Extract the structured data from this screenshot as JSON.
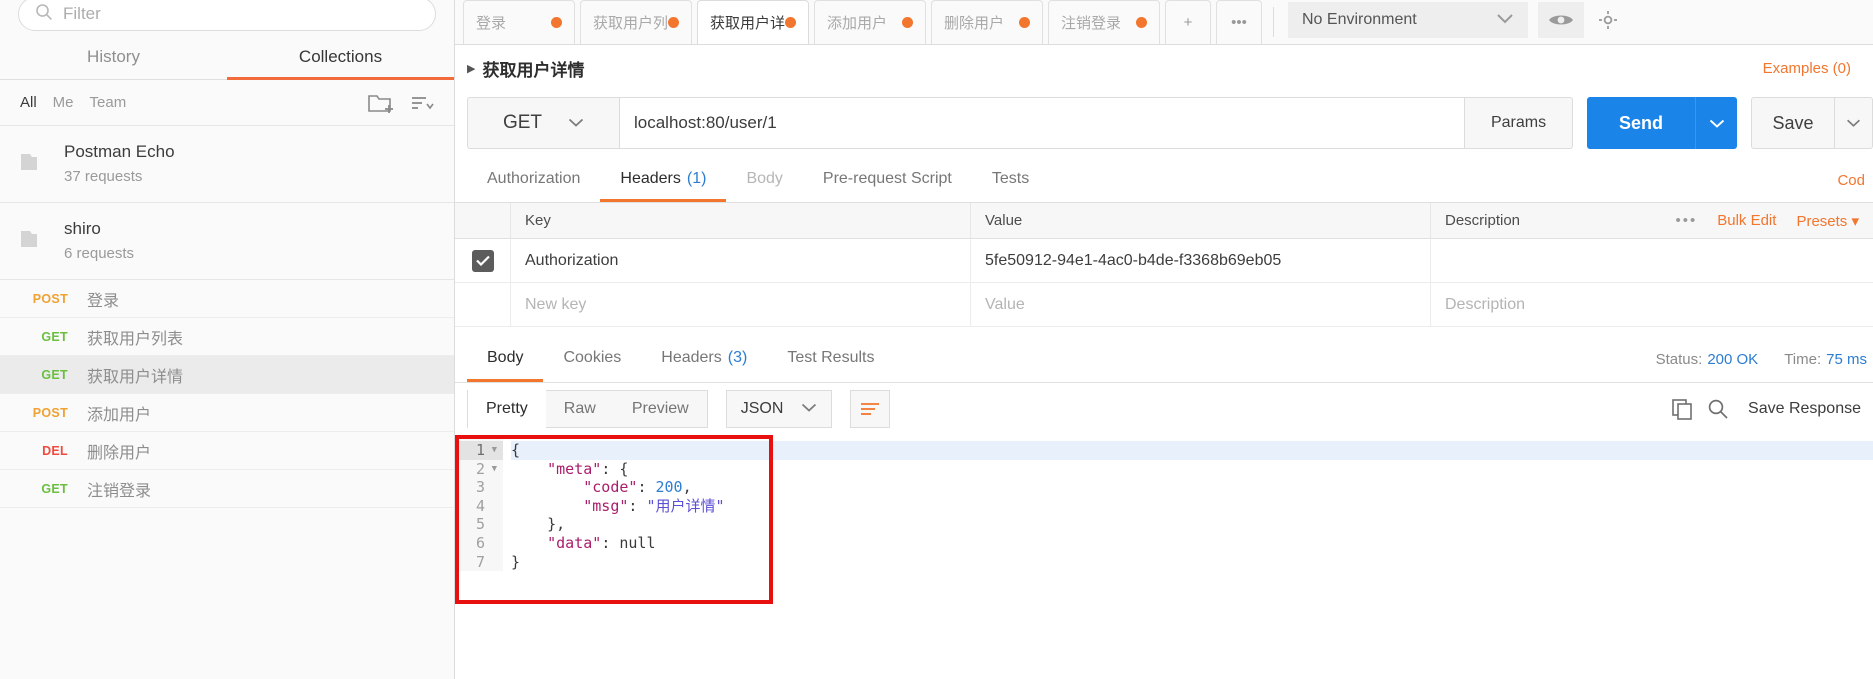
{
  "sidebar": {
    "filter_placeholder": "Filter",
    "tabs": [
      {
        "label": "History",
        "active": false
      },
      {
        "label": "Collections",
        "active": true
      }
    ],
    "scope_filters": [
      {
        "label": "All",
        "active": true
      },
      {
        "label": "Me",
        "active": false
      },
      {
        "label": "Team",
        "active": false
      }
    ],
    "new_folder_icon": "new-folder-icon",
    "sort_icon": "sort-icon",
    "collections": [
      {
        "name": "Postman Echo",
        "count": "37 requests"
      },
      {
        "name": "shiro",
        "count": "6 requests"
      }
    ],
    "requests": [
      {
        "method": "POST",
        "name": "登录",
        "selected": false
      },
      {
        "method": "GET",
        "name": "获取用户列表",
        "selected": false
      },
      {
        "method": "GET",
        "name": "获取用户详情",
        "selected": true
      },
      {
        "method": "POST",
        "name": "添加用户",
        "selected": false
      },
      {
        "method": "DEL",
        "name": "删除用户",
        "selected": false
      },
      {
        "method": "GET",
        "name": "注销登录",
        "selected": false
      }
    ]
  },
  "tabbar": {
    "tabs": [
      {
        "label": "登录",
        "active": false,
        "dirty": true
      },
      {
        "label": "获取用户列",
        "active": false,
        "dirty": true
      },
      {
        "label": "获取用户详",
        "active": true,
        "dirty": true
      },
      {
        "label": "添加用户",
        "active": false,
        "dirty": true
      },
      {
        "label": "删除用户",
        "active": false,
        "dirty": true
      },
      {
        "label": "注销登录",
        "active": false,
        "dirty": true
      }
    ],
    "new_tab_label": "+",
    "more_tabs_label": "•••",
    "environment": "No Environment",
    "eye_icon": "eye-icon",
    "gear_icon": "gear-icon"
  },
  "request": {
    "title": "获取用户详情",
    "examples_label": "Examples (0)",
    "method": "GET",
    "url": "localhost:80/user/1",
    "params_label": "Params",
    "send_label": "Send",
    "save_label": "Save",
    "tabs": [
      {
        "label": "Authorization",
        "active": false,
        "dim": false,
        "count": ""
      },
      {
        "label": "Headers",
        "active": true,
        "dim": false,
        "count": "(1)"
      },
      {
        "label": "Body",
        "active": false,
        "dim": true,
        "count": ""
      },
      {
        "label": "Pre-request Script",
        "active": false,
        "dim": false,
        "count": ""
      },
      {
        "label": "Tests",
        "active": false,
        "dim": false,
        "count": ""
      }
    ],
    "code_link": "Cod",
    "headers_table": {
      "columns": [
        "Key",
        "Value",
        "Description"
      ],
      "ellipsis": "•••",
      "bulk_edit_label": "Bulk Edit",
      "presets_label": "Presets",
      "rows": [
        {
          "checked": true,
          "key": "Authorization",
          "value": "5fe50912-94e1-4ac0-b4de-f3368b69eb05",
          "description": ""
        }
      ],
      "empty_row": {
        "key_placeholder": "New key",
        "value_placeholder": "Value",
        "description_placeholder": "Description"
      }
    }
  },
  "response": {
    "tabs": [
      {
        "label": "Body",
        "active": true,
        "count": ""
      },
      {
        "label": "Cookies",
        "active": false,
        "count": ""
      },
      {
        "label": "Headers",
        "active": false,
        "count": "(3)"
      },
      {
        "label": "Test Results",
        "active": false,
        "count": ""
      }
    ],
    "status_label": "Status:",
    "status_value": "200 OK",
    "time_label": "Time:",
    "time_value": "75 ms",
    "view_modes": [
      {
        "label": "Pretty",
        "active": true
      },
      {
        "label": "Raw",
        "active": false
      },
      {
        "label": "Preview",
        "active": false
      }
    ],
    "format": "JSON",
    "wrap_icon": "word-wrap-icon",
    "copy_icon": "copy-icon",
    "search_icon": "search-icon",
    "save_response_label": "Save Response",
    "body_lines": [
      {
        "n": "1",
        "foldable": true,
        "text": "{"
      },
      {
        "n": "2",
        "foldable": true,
        "text": "    \"meta\": {"
      },
      {
        "n": "3",
        "foldable": false,
        "text": "        \"code\": 200,"
      },
      {
        "n": "4",
        "foldable": false,
        "text": "        \"msg\": \"用户详情\""
      },
      {
        "n": "5",
        "foldable": false,
        "text": "    },"
      },
      {
        "n": "6",
        "foldable": false,
        "text": "    \"data\": null"
      },
      {
        "n": "7",
        "foldable": false,
        "text": "}"
      }
    ]
  },
  "colors": {
    "accent_orange": "#f2762e",
    "send_blue": "#1a84e8",
    "highlight_red": "#e8100f",
    "method_get": "#6bbf3f",
    "method_post": "#f0a132",
    "method_del": "#f04a3f"
  }
}
